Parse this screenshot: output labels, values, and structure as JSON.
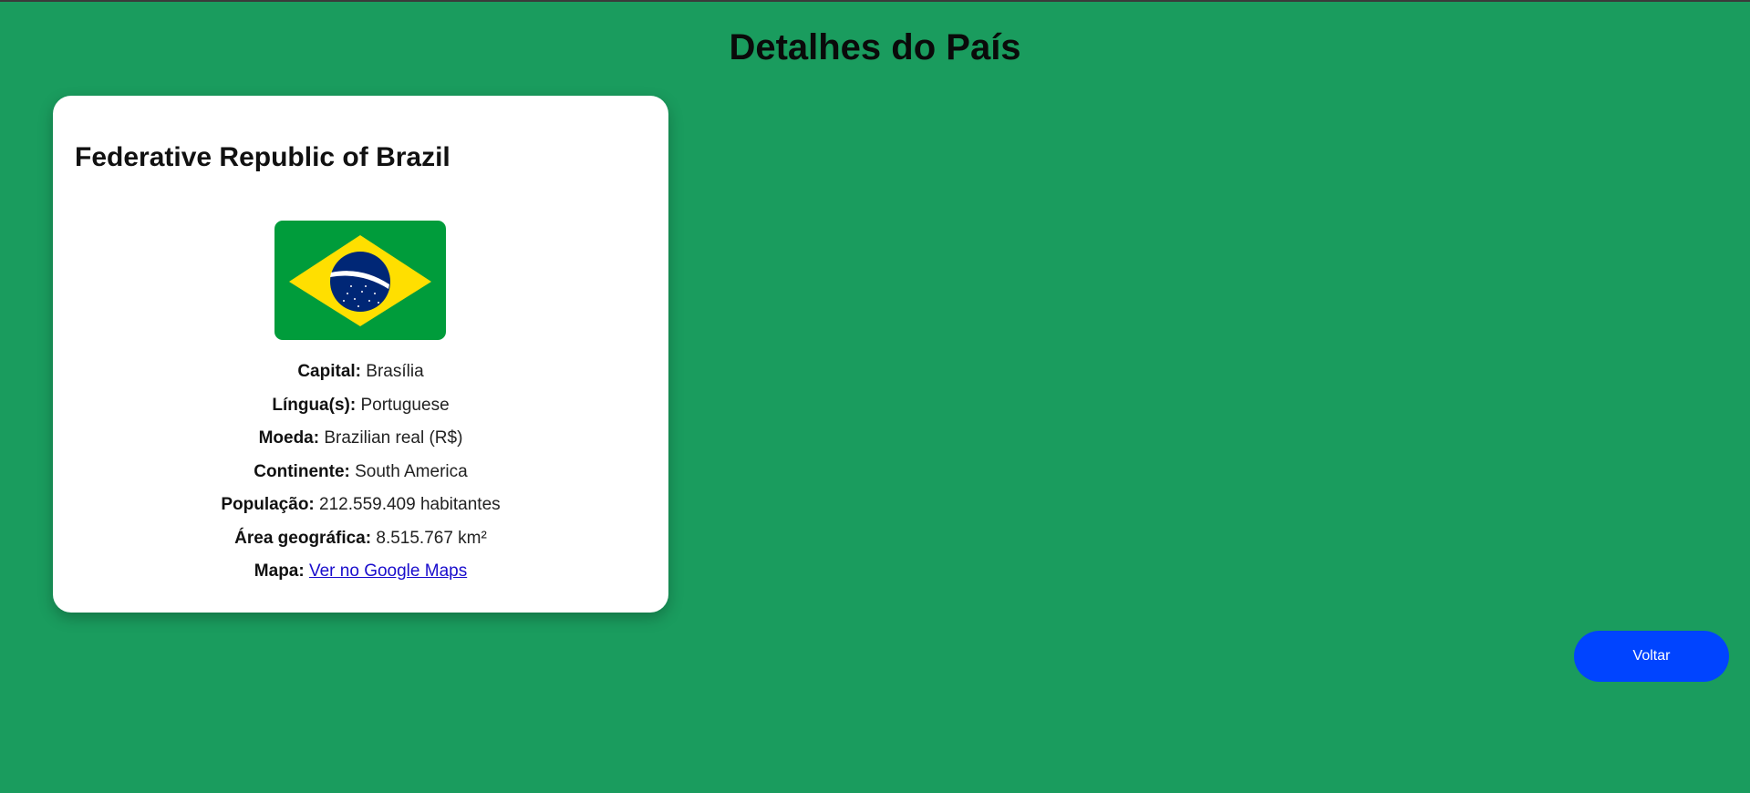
{
  "page": {
    "title": "Detalhes do País"
  },
  "country": {
    "official_name": "Federative Republic of Brazil",
    "flag_icon": "brazil-flag",
    "details": [
      {
        "label": "Capital:",
        "value": "Brasília"
      },
      {
        "label": "Língua(s):",
        "value": "Portuguese"
      },
      {
        "label": "Moeda:",
        "value": "Brazilian real (R$)"
      },
      {
        "label": "Continente:",
        "value": "South America"
      },
      {
        "label": "População:",
        "value": "212.559.409 habitantes"
      },
      {
        "label": "Área geográfica:",
        "value": "8.515.767 km²"
      }
    ],
    "map": {
      "label": "Mapa:",
      "link_text": "Ver no Google Maps"
    }
  },
  "actions": {
    "back_label": "Voltar"
  },
  "colors": {
    "background": "#1a9c5e",
    "card": "#ffffff",
    "button": "#0044ff",
    "link": "#1a0dcc"
  }
}
